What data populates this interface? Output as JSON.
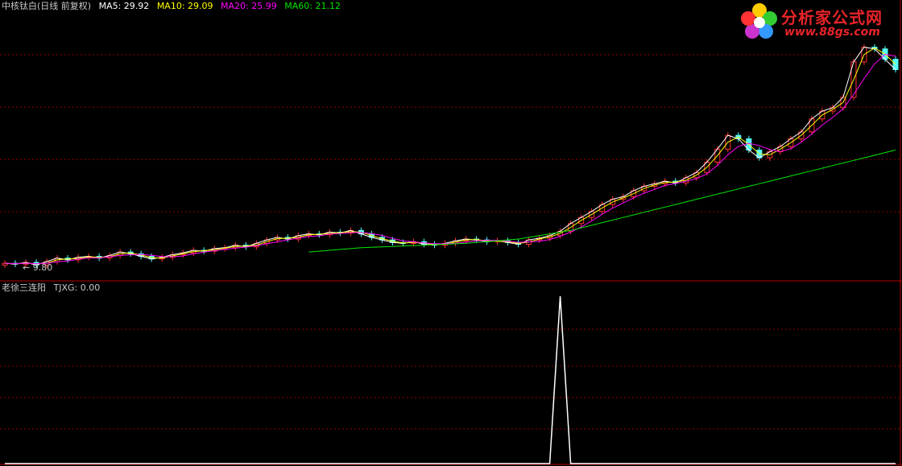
{
  "header": {
    "title": "中核钛白(日线 前复权)",
    "ma5": "MA5: 29.92",
    "ma10": "MA10: 29.09",
    "ma20": "MA20: 25.99",
    "ma60": "MA60: 21.12"
  },
  "indicator": {
    "name": "老徐三连阳",
    "value": "TJXG: 0.00"
  },
  "logo": {
    "title": "分析家公式网",
    "url": "www.88gs.com"
  },
  "low_marker": "← 9.80",
  "colors": {
    "up": "#ff3232",
    "down": "#54fcfc",
    "ma5": "#ffffff",
    "ma10": "#ffff00",
    "ma20": "#ff00ff",
    "ma60": "#00e600",
    "grid": "#8b0000",
    "indicator": "#ffffff"
  },
  "chart_data": {
    "type": "line",
    "price_range": [
      9.0,
      36.0
    ],
    "series": [
      {
        "name": "MA5",
        "close": [
          10.2,
          10.1,
          10.3,
          10.0,
          10.4,
          10.8,
          10.6,
          10.9,
          11.0,
          10.8,
          11.1,
          11.5,
          11.3,
          11.0,
          10.7,
          10.9,
          11.2,
          11.4,
          11.7,
          11.6,
          11.9,
          12.0,
          12.3,
          12.1,
          12.5,
          12.9,
          13.2,
          13.0,
          13.4,
          13.6,
          13.5,
          13.8,
          13.7,
          14.0,
          13.6,
          13.2,
          12.9,
          12.6,
          12.5,
          12.7,
          12.4,
          12.3,
          12.5,
          12.8,
          13.0,
          12.9,
          12.7,
          12.8,
          12.6,
          12.4,
          12.9,
          13.1,
          13.4,
          13.9,
          14.8,
          15.5,
          16.2,
          17.0,
          17.6,
          17.9,
          18.6,
          19.1,
          19.4,
          19.7,
          19.5,
          20.1,
          20.7,
          21.9,
          23.4,
          25.0,
          24.6,
          23.3,
          22.4,
          23.1,
          23.7,
          24.6,
          25.4,
          26.9,
          27.8,
          28.2,
          29.4,
          33.5,
          35.2,
          35.0,
          33.8,
          32.6
        ]
      },
      {
        "name": "MA60",
        "close": [
          null,
          null,
          null,
          null,
          null,
          null,
          null,
          null,
          null,
          null,
          null,
          null,
          null,
          null,
          null,
          null,
          null,
          null,
          null,
          null,
          null,
          null,
          null,
          null,
          null,
          null,
          null,
          null,
          null,
          11.5,
          11.6,
          11.7,
          11.8,
          11.9,
          12.0,
          12.05,
          12.1,
          12.15,
          12.2,
          12.25,
          12.3,
          12.35,
          12.4,
          12.45,
          12.5,
          12.6,
          12.7,
          12.8,
          12.9,
          13.0,
          13.2,
          13.4,
          13.6,
          13.8,
          14.0,
          14.3,
          14.6,
          14.9,
          15.2,
          15.5,
          15.8,
          16.1,
          16.4,
          16.7,
          17.0,
          17.3,
          17.6,
          17.9,
          18.2,
          18.5,
          18.8,
          19.1,
          19.4,
          19.7,
          20.0,
          20.3,
          20.6,
          20.9,
          21.2,
          21.5,
          21.8,
          22.1,
          22.4,
          22.7,
          23.0,
          23.3
        ]
      },
      {
        "name": "TJXG",
        "values": [
          0,
          0,
          0,
          0,
          0,
          0,
          0,
          0,
          0,
          0,
          0,
          0,
          0,
          0,
          0,
          0,
          0,
          0,
          0,
          0,
          0,
          0,
          0,
          0,
          0,
          0,
          0,
          0,
          0,
          0,
          0,
          0,
          0,
          0,
          0,
          0,
          0,
          0,
          0,
          0,
          0,
          0,
          0,
          0,
          0,
          0,
          0,
          0,
          0,
          0,
          0,
          0,
          0,
          1,
          0,
          0,
          0,
          0,
          0,
          0,
          0,
          0,
          0,
          0,
          0,
          0,
          0,
          0,
          0,
          0,
          0,
          0,
          0,
          0,
          0,
          0,
          0,
          0,
          0,
          0,
          0,
          0,
          0,
          0,
          0,
          0
        ]
      }
    ],
    "low_label": 9.8
  }
}
